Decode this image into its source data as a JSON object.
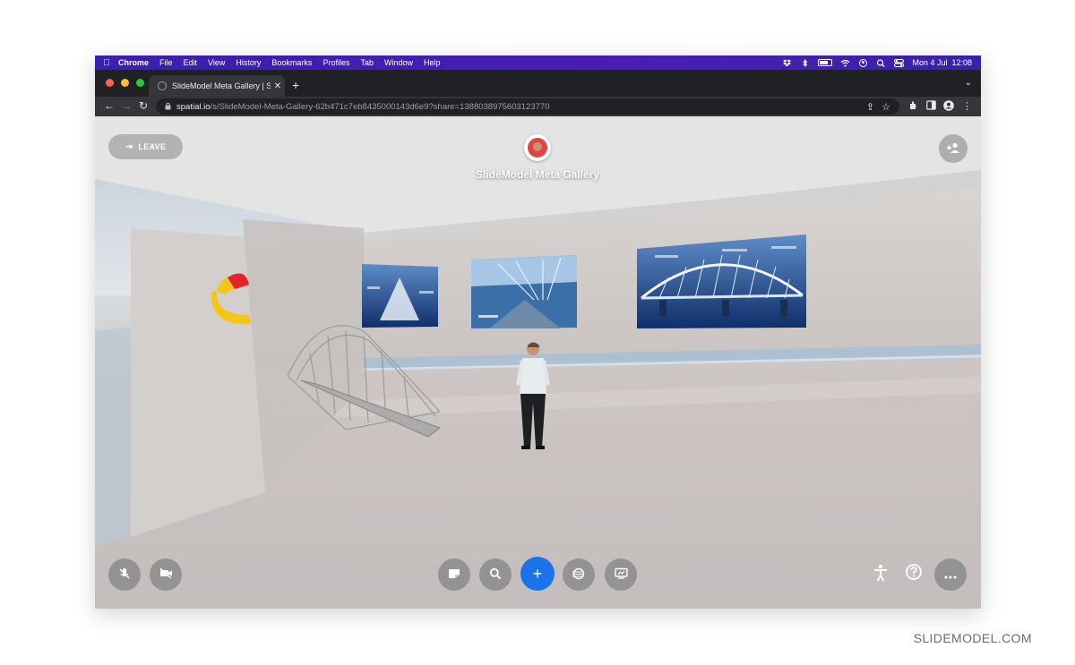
{
  "menubar": {
    "app": "Chrome",
    "items": [
      "File",
      "Edit",
      "View",
      "History",
      "Bookmarks",
      "Profiles",
      "Tab",
      "Window",
      "Help"
    ],
    "clock": "Mon 4 Jul  12:08",
    "icons": [
      "apple-icon",
      "dropbox-icon",
      "bluetooth-icon",
      "battery-icon",
      "wifi-icon",
      "user-switch-icon",
      "spotlight-icon",
      "control-center-icon"
    ]
  },
  "browser": {
    "tab_title": "SlideModel Meta Gallery | Spat",
    "url_host": "spatial.io",
    "url_path": "/s/SlideModel-Meta-Gallery-62b471c7eb8435000143d6e9?share=1388038975603123770",
    "traffic_colors": [
      "#ff5f57",
      "#febc2e",
      "#28c840"
    ]
  },
  "space": {
    "leave_label": "LEAVE",
    "title": "SlideModel Meta Gallery"
  },
  "watermark": "SLIDEMODEL.COM",
  "colors": {
    "accent": "#1a73e8",
    "menubar": "#4a1db5",
    "avatar": "#e2453c"
  }
}
